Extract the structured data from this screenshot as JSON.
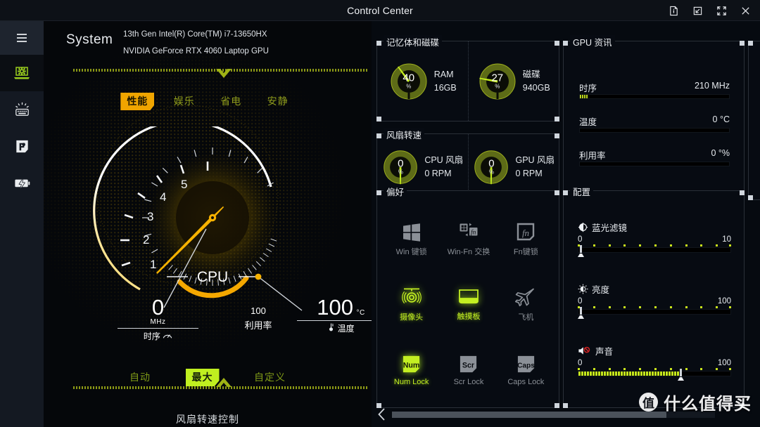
{
  "titlebar": {
    "title": "Control Center",
    "buttons": [
      {
        "name": "info-icon",
        "label": "Info"
      },
      {
        "name": "restore-icon",
        "label": "Restore"
      },
      {
        "name": "fullscreen-icon",
        "label": "Fullscreen"
      },
      {
        "name": "close-icon",
        "label": "Close"
      }
    ]
  },
  "sidebar": {
    "items": [
      {
        "icon": "hamburger-menu-icon",
        "label": "Menu"
      },
      {
        "icon": "system-laptop-gear-icon",
        "label": "System",
        "active": true
      },
      {
        "icon": "keyboard-backlight-icon",
        "label": "Keyboard"
      },
      {
        "icon": "flexikey-f-icon",
        "label": "FlexiKey"
      },
      {
        "icon": "battery-charge-icon",
        "label": "Power"
      }
    ]
  },
  "system": {
    "title": "System",
    "cpu_name": "13th Gen Intel(R) Core(TM) i7-13650HX",
    "gpu_name": "NVIDIA GeForce RTX 4060 Laptop GPU"
  },
  "power_modes": {
    "options": [
      "性能",
      "娱乐",
      "省电",
      "安静"
    ],
    "selected": "性能"
  },
  "cpu_gauge": {
    "center_label": "CPU",
    "scale_ticks": [
      "1",
      "2",
      "3",
      "4",
      "5"
    ],
    "needle_value": 0,
    "clock": {
      "value": "0",
      "unit": "MHz",
      "label": "时序",
      "icon": "speedometer-icon"
    },
    "utilization": {
      "value": "100",
      "label": "利用率"
    },
    "temperature": {
      "value": "100",
      "unit": "°C",
      "label": "温度",
      "icon": "thermometer-icon"
    }
  },
  "fan_control": {
    "options": [
      "自动",
      "最大",
      "自定义"
    ],
    "selected": "最大",
    "caption": "风扇转速控制"
  },
  "memory_disk": {
    "title": "记忆体和磁碟",
    "gauges": [
      {
        "percent": 40,
        "unit": "%",
        "name": "RAM",
        "capacity": "16GB"
      },
      {
        "percent": 27,
        "unit": "%",
        "name": "磁碟",
        "capacity": "940GB"
      }
    ]
  },
  "fan_speed": {
    "title": "风扇转速",
    "gauges": [
      {
        "percent": 0,
        "unit": "%",
        "name": "CPU 风扇",
        "rpm": "0 RPM"
      },
      {
        "percent": 0,
        "unit": "%",
        "name": "GPU 风扇",
        "rpm": "0 RPM"
      }
    ]
  },
  "gpu_info": {
    "title": "GPU 资讯",
    "rows": [
      {
        "label": "时序",
        "value": "210 MHz",
        "fill_percent": 5
      },
      {
        "label": "温度",
        "value": "0 °C",
        "fill_percent": 0
      },
      {
        "label": "利用率",
        "value": "0 °%",
        "fill_percent": 0
      }
    ]
  },
  "preferences": {
    "title": "偏好",
    "items": [
      {
        "label": "Win 键锁",
        "icon": "windows-logo-icon",
        "on": false
      },
      {
        "label": "Win-Fn 交换",
        "icon": "win-fn-swap-icon",
        "on": false
      },
      {
        "label": "Fn键锁",
        "icon": "fn-key-icon",
        "on": false
      },
      {
        "label": "摄像头",
        "icon": "camera-icon",
        "on": true
      },
      {
        "label": "触摸板",
        "icon": "touchpad-icon",
        "on": true
      },
      {
        "label": "飞机",
        "icon": "airplane-icon",
        "on": false
      },
      {
        "label": "Num Lock",
        "icon": "num-lock-icon",
        "on": true
      },
      {
        "label": "Scr Lock",
        "icon": "scr-lock-icon",
        "on": false
      },
      {
        "label": "Caps Lock",
        "icon": "caps-lock-icon",
        "on": false
      }
    ]
  },
  "configuration": {
    "title": "配置",
    "sliders": [
      {
        "label": "蓝光滤镜",
        "icon": "bluelight-filter-icon",
        "min": "0",
        "max": "10",
        "value": 0,
        "fill_percent": 0
      },
      {
        "label": "亮度",
        "icon": "brightness-icon",
        "min": "0",
        "max": "100",
        "value": 0,
        "fill_percent": 0
      },
      {
        "label": "声音",
        "icon": "volume-muted-icon",
        "min": "0",
        "max": "100",
        "value": 67,
        "fill_percent": 67
      }
    ]
  },
  "footer": {
    "prev_label": "Previous"
  },
  "watermark": {
    "logo_char": "值",
    "text": "什么值得买"
  },
  "colors": {
    "accent_amber": "#f0a500",
    "accent_green": "#c0ef20",
    "panel_bg": "#070b12",
    "sidebar_bg": "#141922"
  }
}
